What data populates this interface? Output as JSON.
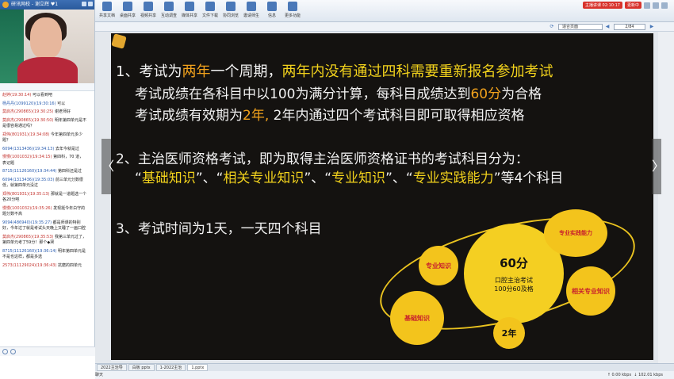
{
  "window": {
    "title": "研讯网校 - 谢立辉 ♥1"
  },
  "chat": {
    "messages": [
      {
        "who": "赵婷(",
        "time": "19:30:14)",
        "text": "可以看到吧"
      },
      {
        "who": "杨丹丹(1099120)",
        "time": "(19:30:16)",
        "text": "可以"
      },
      {
        "who": "莫启杰(290865)",
        "time": "(19:30:25)",
        "text": "谢老师好"
      },
      {
        "who": "莫启杰(290865)",
        "time": "(19:30:50)",
        "text": "明年第四单元是不是很容易通过吗？"
      },
      {
        "who": "郑伟(801931)",
        "time": "(19:34:08)",
        "text": "今年第四单元多少题？"
      },
      {
        "who": "6094(1313436)",
        "time": "(19:34:13)",
        "text": "去年今就是过"
      },
      {
        "who": "慢慢(1001032)",
        "time": "(19:34:15)",
        "text": "第四科，70 道，表记题"
      },
      {
        "who": "8715(11126160)",
        "time": "(19:34:44)",
        "text": "第四科还是过"
      },
      {
        "who": "6094(1313436)",
        "time": "(19:35:03)",
        "text": "前三单元分数很低，就第四单元没过"
      },
      {
        "who": "郑伟(801931)",
        "time": "(19:35:13)",
        "text": "那就是一道题选一个各20分吧"
      },
      {
        "who": "慢慢(1001032)",
        "time": "(19:35:26)",
        "text": "发现挺今年白守的题分数不高"
      },
      {
        "who": "9094(486940)",
        "time": "(19:35:27)",
        "text": "都是师课的特别好，今年过了就是考试头天晚上又睡了一画口腔"
      },
      {
        "who": "莫启杰(290865)",
        "time": "(19:35:53)",
        "text": "我第三单元过了，第四单元考了59分！那个◆哭"
      },
      {
        "who": "8715(11126160)",
        "time": "(19:36:14)",
        "text": "明年第四单元是不是也这样，都是多选"
      },
      {
        "who": "2573(11129024)",
        "time": "(19:36:43)",
        "text": "抗磨的四单元"
      }
    ]
  },
  "toolbar": {
    "items": [
      "共享文档",
      "桌面共享",
      "视频共享",
      "互动调查",
      "媒体共享",
      "文件下载",
      "协同浏览",
      "邀请师生",
      "信息",
      "更多功能"
    ],
    "badge1": "主播讲课 02:10:17",
    "badge2": "更新中"
  },
  "viewer": {
    "fit": "适合页面",
    "page": "2/84"
  },
  "slide": {
    "l1a": "1、考试为",
    "l1b": "两年",
    "l1c": "一个周期，",
    "l1d": "两年内没有通过四科需要重新报名参加考试",
    "l2a": "考试成绩在各科目中以100为满分计算，每科目成绩达到",
    "l2b": "60分",
    "l2c": "为合格",
    "l3a": "考试成绩有效期为",
    "l3b": "2年,",
    "l3c": " 2年内通过四个考试科目即可取得相应资格",
    "l4": "2、主治医师资格考试，即为取得主治医师资格证书的考试科目分为：",
    "l5a": "“",
    "l5b": "基础知识",
    "l5c": "”、“",
    "l5d": "相关专业知识",
    "l5e": "”、“",
    "l5f": "专业知识",
    "l5g": "”、“",
    "l5h": "专业实践能力",
    "l5i": "”等4个科目",
    "l6": "3、考试时间为1天，一天四个科目",
    "diagram": {
      "center_big": "60分",
      "center_sub1": "口腔主治考试",
      "center_sub2": "100分60及格",
      "c_zhuanye": "专业知识",
      "c_shijian": "专业实践能力",
      "c_xiangguan": "相关专业知识",
      "c_jichu": "基础知识",
      "c_2nian": "2年"
    }
  },
  "tabs": [
    "2022主治导",
    "白板 pptx",
    "1-2022主治",
    "1.pptx"
  ],
  "status": {
    "chat": "聊天",
    "upload": "0.00 kbps",
    "download": "102.01 kbps"
  }
}
